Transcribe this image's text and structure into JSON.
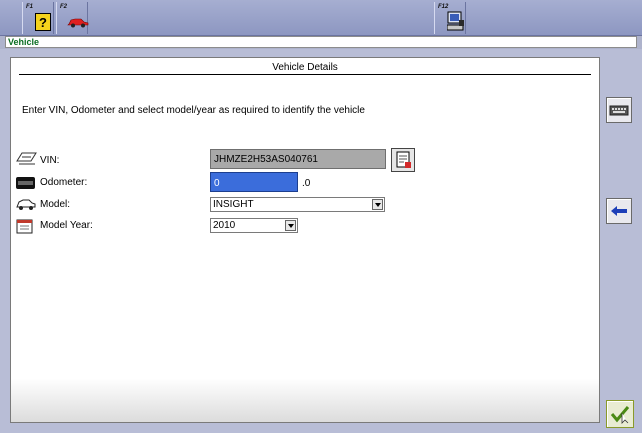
{
  "toolbar": {
    "f1_label": "F1",
    "f2_label": "F2",
    "f12_label": "F12",
    "f1_icon": "help-icon",
    "f2_icon": "car-icon",
    "f12_icon": "computer-icon"
  },
  "breadcrumb": "Vehicle",
  "panel": {
    "title": "Vehicle Details",
    "instruction": "Enter VIN, Odometer and select model/year as required to identify the vehicle"
  },
  "form": {
    "vin_label": "VIN:",
    "vin_value": "JHMZE2H53AS040761",
    "odometer_label": "Odometer:",
    "odometer_value": "0",
    "odometer_suffix": ".0",
    "model_label": "Model:",
    "model_value": "INSIGHT",
    "year_label": "Model Year:",
    "year_value": "2010"
  },
  "side_buttons": {
    "keyboard_icon": "keyboard-icon",
    "back_icon": "arrow-left-icon",
    "confirm_icon": "checkmark-icon"
  },
  "colors": {
    "toolbar": "#9aa3cc",
    "breadcrumb_text": "#0b6e22",
    "odometer_field": "#3b6ddb",
    "back_arrow": "#1d3fb8",
    "confirm": "#5a9b1a"
  }
}
